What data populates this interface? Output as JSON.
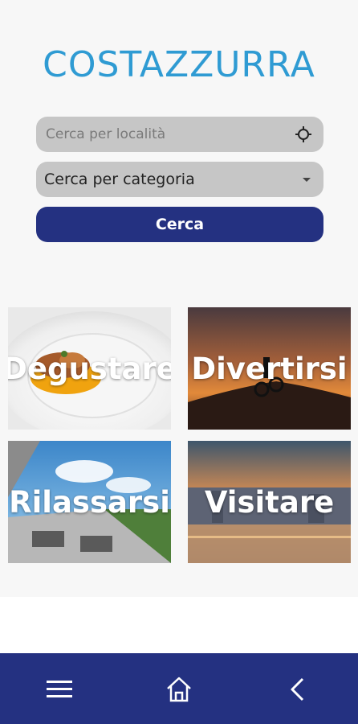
{
  "brand": {
    "name": "COSTAZZURRA",
    "color": "#2f9bd3"
  },
  "search": {
    "location_placeholder": "Cerca per località",
    "location_icon": "target-icon",
    "category_value": "Cerca per categoria",
    "category_icon": "dropdown-caret-icon",
    "button_label": "Cerca"
  },
  "categories": [
    {
      "label": "Degustare"
    },
    {
      "label": "Divertirsi"
    },
    {
      "label": "Rilassarsi"
    },
    {
      "label": "Visitare"
    }
  ],
  "bottom_nav": {
    "icons": [
      "menu-icon",
      "home-icon",
      "back-icon"
    ]
  },
  "colors": {
    "accent": "#243181",
    "field_bg": "#c6c6c6",
    "background": "#f7f7f7"
  }
}
